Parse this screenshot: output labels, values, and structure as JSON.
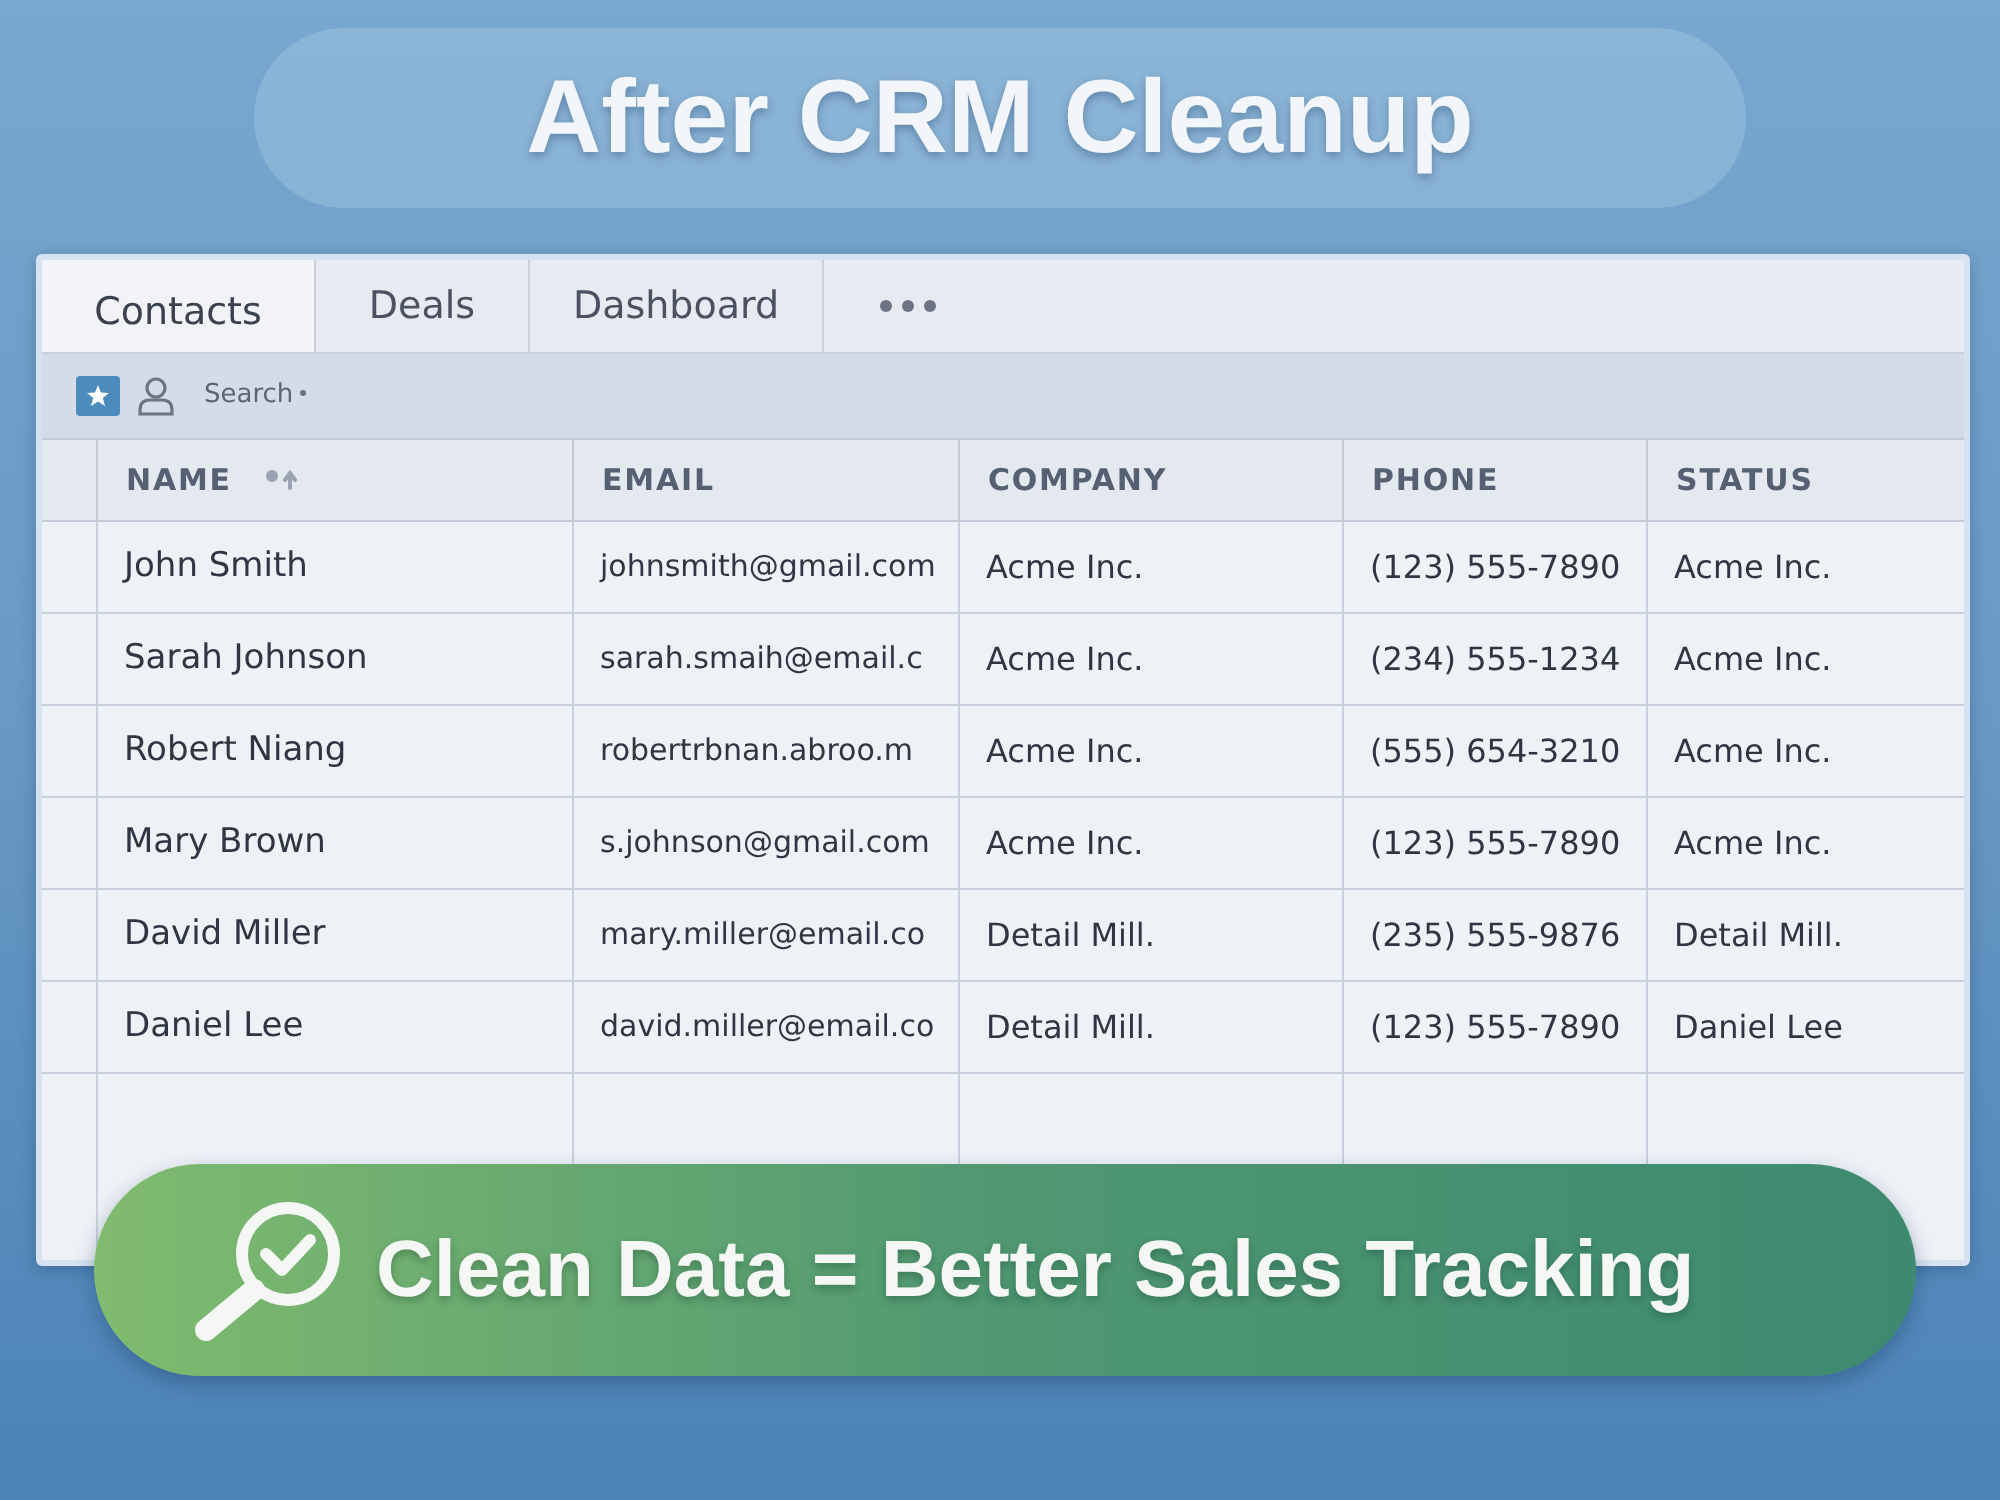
{
  "title": "After CRM Cleanup",
  "tabs": [
    {
      "label": "Contacts",
      "selected": true
    },
    {
      "label": "Deals",
      "selected": false
    },
    {
      "label": "Dashboard",
      "selected": false
    }
  ],
  "search": {
    "placeholder": "Search"
  },
  "table": {
    "columns": [
      "NAME",
      "EMAIL",
      "COMPANY",
      "PHONE",
      "STATUS"
    ],
    "rows": [
      [
        "John Smith",
        "johnsmith@gmail.com",
        "Acme Inc.",
        "(123) 555-7890",
        "Acme Inc."
      ],
      [
        "Sarah Johnson",
        "sarah.smaih@email.c",
        "Acme Inc.",
        "(234) 555-1234",
        "Acme Inc."
      ],
      [
        "Robert Niang",
        "robertrbnan.abroo.m",
        "Acme Inc.",
        "(555) 654-3210",
        "Acme Inc."
      ],
      [
        "Mary Brown",
        "s.johnson@gmail.com",
        "Acme Inc.",
        "(123) 555-7890",
        "Acme Inc."
      ],
      [
        "David Miller",
        "mary.miller@email.co",
        "Detail Mill.",
        "(235) 555-9876",
        "Detail Mill."
      ],
      [
        "Daniel Lee",
        "david.miller@email.co",
        "Detail Mill.",
        "(123) 555-7890",
        "Daniel Lee"
      ]
    ]
  },
  "banner": {
    "text": "Clean Data = Better Sales Tracking"
  }
}
